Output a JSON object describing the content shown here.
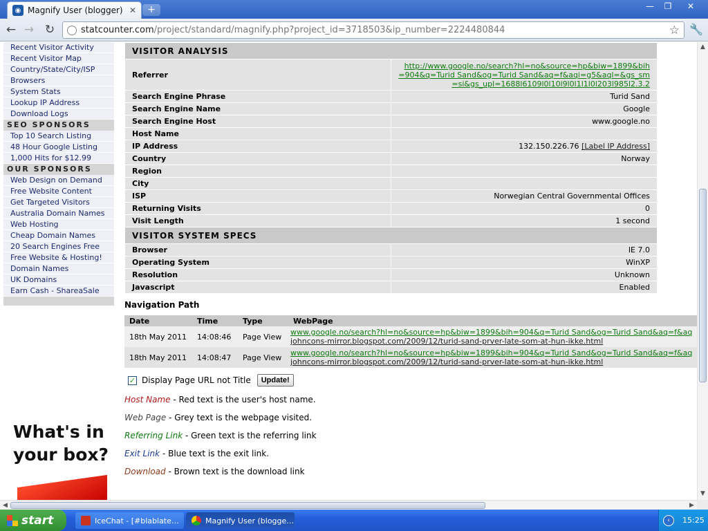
{
  "browser": {
    "tab_title": "Magnify User (blogger)",
    "tab_close": "✕",
    "new_tab": "+",
    "win_min": "—",
    "win_max": "❐",
    "win_close": "✕",
    "url_host": "statcounter.com",
    "url_path": "/project/standard/magnify.php?project_id=3718503&ip_number=2224480844",
    "star": "☆",
    "back": "←",
    "forward": "→",
    "reload": "↻",
    "wrench": "🔧"
  },
  "sidebar": {
    "items_top": [
      "Recent Visitor Activity",
      "Recent Visitor Map",
      "Country/State/City/ISP",
      "Browsers",
      "System Stats",
      "Lookup IP Address",
      "Download Logs"
    ],
    "seo_heading": "SEO SPONSORS",
    "seo_items": [
      "Top 10 Search Listing",
      "48 Hour Google Listing",
      "1,000 Hits for $12.99"
    ],
    "our_heading": "OUR SPONSORS",
    "our_items": [
      "Web Design on Demand",
      "Free Website Content",
      "Get Targeted Visitors",
      "Australia Domain Names",
      "Web Hosting",
      "Cheap Domain Names",
      "20 Search Engines Free",
      "Free Website & Hosting!",
      "Domain Names",
      "UK Domains",
      "Earn Cash - ShareaSale"
    ]
  },
  "ad": {
    "line1": "What's in",
    "line2": "your box?"
  },
  "visitor_analysis": {
    "heading": "VISITOR ANALYSIS",
    "referrer_label": "Referrer",
    "referrer_value": "http://www.google.no/search?hl=no&source=hp&biw=1899&bih=904&q=Turid Sand&og=Turid Sand&aq=f&aqi=g5&aql=&gs_sm=si&gs_upl=1688l6109l0l10l9l0l1l1l0l203l985l2.3.2",
    "rows": [
      {
        "label": "Search Engine Phrase",
        "value": "Turid Sand"
      },
      {
        "label": "Search Engine Name",
        "value": "Google"
      },
      {
        "label": "Search Engine Host",
        "value": "www.google.no"
      },
      {
        "label": "Host Name",
        "value": ""
      },
      {
        "label": "IP Address",
        "value": "132.150.226.76",
        "link": "[Label IP Address]"
      },
      {
        "label": "Country",
        "value": "Norway"
      },
      {
        "label": "Region",
        "value": ""
      },
      {
        "label": "City",
        "value": ""
      },
      {
        "label": "ISP",
        "value": "Norwegian Central Governmental Offices"
      },
      {
        "label": "Returning Visits",
        "value": "0"
      },
      {
        "label": "Visit Length",
        "value": "1 second"
      }
    ]
  },
  "system_specs": {
    "heading": "VISITOR SYSTEM SPECS",
    "rows": [
      {
        "label": "Browser",
        "value": "IE 7.0"
      },
      {
        "label": "Operating System",
        "value": "WinXP"
      },
      {
        "label": "Resolution",
        "value": "Unknown"
      },
      {
        "label": "Javascript",
        "value": "Enabled"
      }
    ]
  },
  "navigation": {
    "title": "Navigation Path",
    "headers": {
      "date": "Date",
      "time": "Time",
      "type": "Type",
      "webpage": "WebPage"
    },
    "rows": [
      {
        "date": "18th May 2011",
        "time": "14:08:46",
        "type": "Page View",
        "ref": "www.google.no/search?hl=no&source=hp&biw=1899&bih=904&q=Turid Sand&og=Turid Sand&aq=f&aqi=g5",
        "page": "johncons-mirror.blogspot.com/2009/12/turid-sand-prver-late-som-at-hun-ikke.html"
      },
      {
        "date": "18th May 2011",
        "time": "14:08:47",
        "type": "Page View",
        "ref": "www.google.no/search?hl=no&source=hp&biw=1899&bih=904&q=Turid Sand&og=Turid Sand&aq=f&aqi=g5",
        "page": "johncons-mirror.blogspot.com/2009/12/turid-sand-prver-late-som-at-hun-ikke.html"
      }
    ]
  },
  "options": {
    "checkbox_mark": "✓",
    "checkbox_label": "Display Page URL not Title",
    "update_button": "Update!"
  },
  "legend": [
    {
      "term": "Host Name",
      "desc": " - Red text is the user's host name.",
      "color": "#b01818"
    },
    {
      "term": "Web Page",
      "desc": " - Grey text is the webpage visited.",
      "color": "#444444"
    },
    {
      "term": "Referring Link",
      "desc": " - Green text is the referring link",
      "color": "#0d7a0d"
    },
    {
      "term": "Exit Link",
      "desc": " - Blue text is the exit link.",
      "color": "#1a3d9a"
    },
    {
      "term": "Download",
      "desc": " - Brown text is the download link",
      "color": "#8b3a1a"
    }
  ],
  "scroll": {
    "up": "▲",
    "down": "▼",
    "left": "◀",
    "right": "▶"
  },
  "taskbar": {
    "start": "start",
    "tasks": [
      "IceChat - [#blablate…",
      "Magnify User (blogge…"
    ],
    "tray_arrow": "‹",
    "clock": "15:25"
  }
}
